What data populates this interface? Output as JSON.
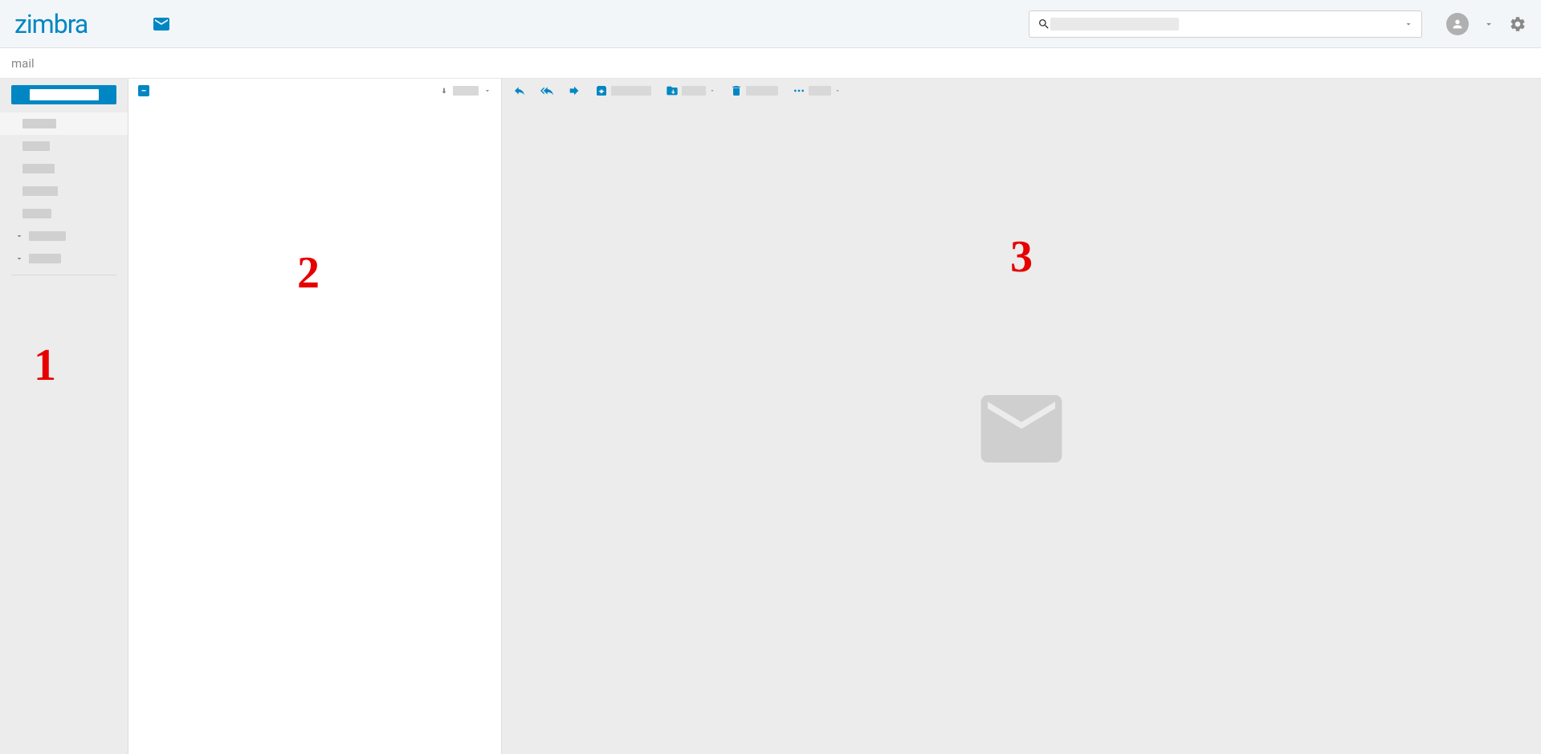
{
  "app_name": "zimbra",
  "breadcrumb": "mail",
  "search_placeholder": "",
  "sidebar": {
    "compose_label": "",
    "folders": [
      {
        "label_width": 42,
        "selected": true,
        "expandable": false
      },
      {
        "label_width": 34,
        "selected": false,
        "expandable": false
      },
      {
        "label_width": 40,
        "selected": false,
        "expandable": false
      },
      {
        "label_width": 44,
        "selected": false,
        "expandable": false
      },
      {
        "label_width": 36,
        "selected": false,
        "expandable": false
      },
      {
        "label_width": 46,
        "selected": false,
        "expandable": true
      },
      {
        "label_width": 40,
        "selected": false,
        "expandable": true
      }
    ]
  },
  "list": {
    "sort_label": ""
  },
  "toolbar": {
    "reply_label": "",
    "reply_all_label": "",
    "forward_label": "",
    "archive_label": "",
    "move_label": "",
    "delete_label": "",
    "more_label": ""
  },
  "annotations": {
    "a1": "1",
    "a2": "2",
    "a3": "3"
  }
}
